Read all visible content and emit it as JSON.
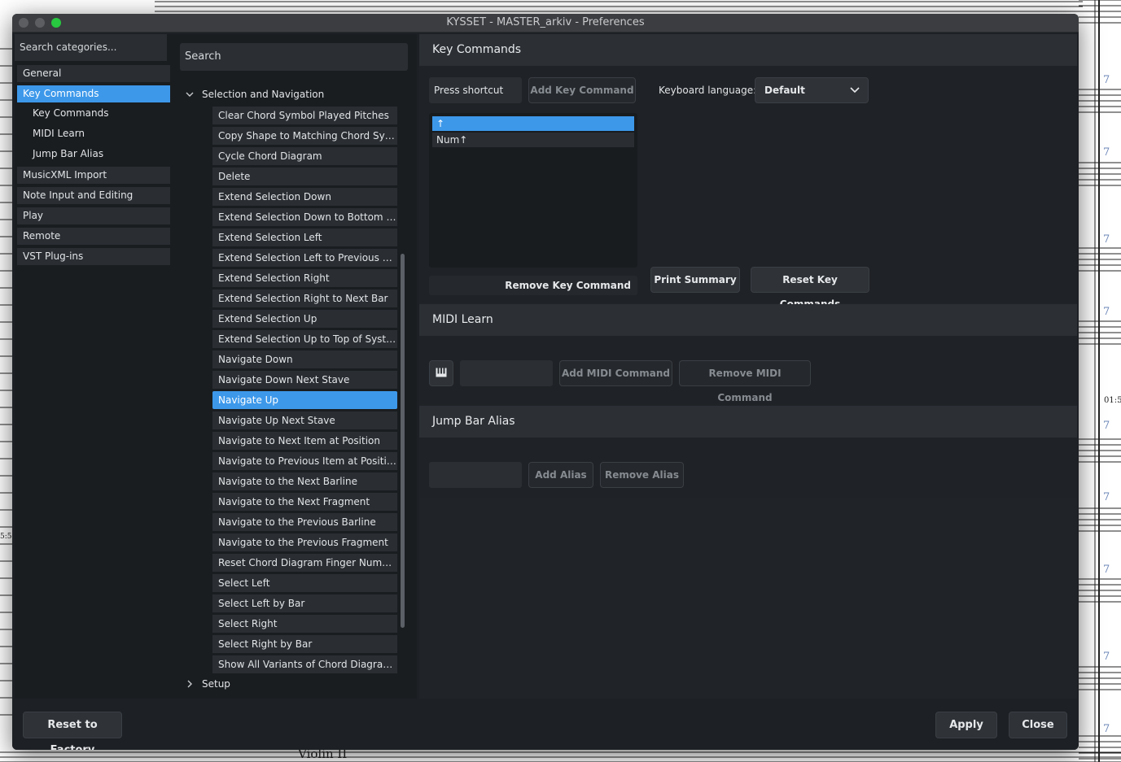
{
  "window": {
    "title": "KYSSET - MASTER_arkiv - Preferences"
  },
  "score": {
    "bar_numbers": [
      "7",
      "7",
      "7",
      "7",
      "7",
      "7",
      "7",
      "7",
      "7"
    ],
    "time_code": "01:5",
    "left_marker": "5:5",
    "instrument": "Violin II"
  },
  "categories": {
    "search_placeholder": "Search categories...",
    "items": [
      {
        "label": "General"
      },
      {
        "label": "Key Commands",
        "selected": true
      },
      {
        "label": "MusicXML Import"
      },
      {
        "label": "Note Input and Editing"
      },
      {
        "label": "Play"
      },
      {
        "label": "Remote"
      },
      {
        "label": "VST Plug-ins"
      }
    ],
    "subitems": [
      {
        "label": "Key Commands"
      },
      {
        "label": "MIDI Learn"
      },
      {
        "label": "Jump Bar Alias"
      }
    ]
  },
  "commands": {
    "search_placeholder": "Search",
    "group_expanded": "Selection and Navigation",
    "group_collapsed": "Setup",
    "items": [
      "Clear Chord Symbol Played Pitches",
      "Copy Shape to Matching Chord Symb...",
      "Cycle Chord Diagram",
      "Delete",
      "Extend Selection Down",
      "Extend Selection Down to Bottom of ...",
      "Extend Selection Left",
      "Extend Selection Left to Previous Bar",
      "Extend Selection Right",
      "Extend Selection Right to Next Bar",
      "Extend Selection Up",
      "Extend Selection Up to Top of System",
      "Navigate Down",
      "Navigate Down Next Stave",
      "Navigate Up",
      "Navigate Up Next Stave",
      "Navigate to Next Item at Position",
      "Navigate to Previous Item at Position",
      "Navigate to the Next Barline",
      "Navigate to the Next Fragment",
      "Navigate to the Previous Barline",
      "Navigate to the Previous Fragment",
      "Reset Chord Diagram Finger Numberi...",
      "Select Left",
      "Select Left by Bar",
      "Select Right",
      "Select Right by Bar",
      "Show All Variants of Chord Diagram..."
    ],
    "selected_index": 14
  },
  "key_commands": {
    "header": "Key Commands",
    "press_shortcut": "Press shortcut",
    "add_key_command": "Add Key Command",
    "keyboard_language_label": "Keyboard language:",
    "keyboard_language_value": "Default",
    "shortcuts": [
      "↑",
      "Num↑"
    ],
    "remove_key_command": "Remove Key Command",
    "print_summary": "Print Summary",
    "reset_key_commands": "Reset Key Commands"
  },
  "midi_learn": {
    "header": "MIDI Learn",
    "add_midi_command": "Add MIDI Command",
    "remove_midi_command": "Remove MIDI Command"
  },
  "jump_bar_alias": {
    "header": "Jump Bar Alias",
    "add_alias": "Add Alias",
    "remove_alias": "Remove Alias"
  },
  "footer": {
    "reset_to_factory": "Reset to Factory",
    "apply": "Apply",
    "close": "Close"
  },
  "colors": {
    "accent": "#3d98ea",
    "panel": "#1a1d20",
    "traffic_close": "#5c5e61",
    "traffic_min": "#5c5e61",
    "traffic_max": "#28c840"
  }
}
